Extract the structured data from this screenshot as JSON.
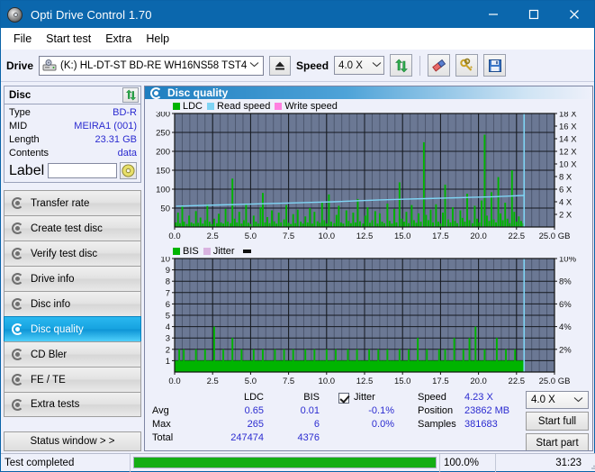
{
  "window": {
    "title": "Opti Drive Control 1.70",
    "icon": "disc-icon",
    "minimize": "minimize-icon",
    "maximize": "maximize-icon",
    "close": "close-icon"
  },
  "menu": {
    "items": [
      "File",
      "Start test",
      "Extra",
      "Help"
    ]
  },
  "toolbar": {
    "drive_label": "Drive",
    "drive_value": "(K:)  HL-DT-ST BD-RE  WH16NS58 TST4",
    "eject_icon": "eject-icon",
    "speed_label": "Speed",
    "speed_value": "4.0 X",
    "refresh_icon": "refresh-icon",
    "erase_icon": "eraser-icon",
    "keys_icon": "keys-icon",
    "save_icon": "save-icon"
  },
  "disc": {
    "title": "Disc",
    "refresh_icon": "refresh-icon",
    "rows": [
      {
        "key": "Type",
        "value": "BD-R"
      },
      {
        "key": "MID",
        "value": "MEIRA1 (001)"
      },
      {
        "key": "Length",
        "value": "23.31 GB"
      },
      {
        "key": "Contents",
        "value": "data"
      }
    ],
    "label_key": "Label",
    "label_value": "",
    "disc_button_icon": "cd-icon"
  },
  "sidebar": {
    "items": [
      {
        "label": "Transfer rate",
        "active": false
      },
      {
        "label": "Create test disc",
        "active": false
      },
      {
        "label": "Verify test disc",
        "active": false
      },
      {
        "label": "Drive info",
        "active": false
      },
      {
        "label": "Disc info",
        "active": false
      },
      {
        "label": "Disc quality",
        "active": true
      },
      {
        "label": "CD Bler",
        "active": false
      },
      {
        "label": "FE / TE",
        "active": false
      },
      {
        "label": "Extra tests",
        "active": false
      }
    ],
    "status_window": "Status window > >"
  },
  "main": {
    "title": "Disc quality",
    "icon": "disc-quality-icon"
  },
  "stats": {
    "col_headers": [
      "",
      "LDC",
      "BIS"
    ],
    "rows": [
      {
        "label": "Avg",
        "ldc": "0.65",
        "bis": "0.01",
        "jitter": "-0.1%"
      },
      {
        "label": "Max",
        "ldc": "265",
        "bis": "6",
        "jitter": "0.0%"
      },
      {
        "label": "Total",
        "ldc": "247474",
        "bis": "4376",
        "jitter": ""
      }
    ],
    "jitter_label": "Jitter",
    "jitter_checked": true,
    "speed_label": "Speed",
    "speed_value": "4.23 X",
    "position_label": "Position",
    "position_value": "23862 MB",
    "samples_label": "Samples",
    "samples_value": "381683",
    "speed_select": "4.0 X",
    "start_full": "Start full",
    "start_part": "Start part"
  },
  "statusbar": {
    "message": "Test completed",
    "percent_label": "100.0%",
    "percent": 100,
    "time": "31:23"
  },
  "colors": {
    "ldc": "#00b400",
    "bis": "#00b400",
    "read_speed": "#7fd4f4",
    "write_speed": "#ff7fe0",
    "jitter": "#d9b3e0",
    "plot_bg": "#6b7894",
    "accent": "#0b67ad",
    "value_text": "#2b2bd0",
    "progress": "#14ae14"
  },
  "chart_data": [
    {
      "type": "bar",
      "id": "ldc-chart",
      "title": "",
      "legend": [
        {
          "label": "LDC",
          "color": "#00b400"
        },
        {
          "label": "Read speed",
          "color": "#7fd4f4"
        },
        {
          "label": "Write speed",
          "color": "#ff7fe0"
        }
      ],
      "legend_position": "top-left",
      "xlabel": "",
      "x_unit": "GB",
      "xlim": [
        0,
        25
      ],
      "xticks": [
        0.0,
        2.5,
        5.0,
        7.5,
        10.0,
        12.5,
        15.0,
        17.5,
        20.0,
        22.5,
        25.0
      ],
      "xtick_labels": [
        "0.0",
        "2.5",
        "5.0",
        "7.5",
        "10.0",
        "12.5",
        "15.0",
        "17.5",
        "20.0",
        "22.5",
        "25.0 GB"
      ],
      "ylabel": "",
      "ylim": [
        0,
        300
      ],
      "yticks": [
        50,
        100,
        150,
        200,
        250,
        300
      ],
      "ytick_labels": [
        "50",
        "100",
        "150",
        "200",
        "250",
        "300"
      ],
      "y2lim": [
        0,
        18
      ],
      "y2ticks": [
        2,
        4,
        6,
        8,
        10,
        12,
        14,
        16,
        18
      ],
      "y2tick_labels": [
        "2 X",
        "4 X",
        "6 X",
        "8 X",
        "10 X",
        "12 X",
        "14 X",
        "16 X",
        "18 X"
      ],
      "grid": true,
      "data_end_x": 23.0,
      "series": [
        {
          "name": "LDC",
          "color": "#00b400",
          "type": "bar",
          "x": [
            0.08,
            0.22,
            0.35,
            0.5,
            0.62,
            0.8,
            0.95,
            1.1,
            1.25,
            1.4,
            1.55,
            1.7,
            1.85,
            2.0,
            2.15,
            2.3,
            2.45,
            2.6,
            2.78,
            2.9,
            3.05,
            3.2,
            3.35,
            3.5,
            3.68,
            3.8,
            3.95,
            4.1,
            4.25,
            4.4,
            4.55,
            4.7,
            4.85,
            5.0,
            5.2,
            5.35,
            5.5,
            5.65,
            5.8,
            5.95,
            6.1,
            6.25,
            6.4,
            6.55,
            6.7,
            6.85,
            7.0,
            7.2,
            7.35,
            7.5,
            7.65,
            7.8,
            7.95,
            8.1,
            8.3,
            8.45,
            8.6,
            8.75,
            8.9,
            9.05,
            9.2,
            9.4,
            9.55,
            9.7,
            9.85,
            10.0,
            10.15,
            10.3,
            10.5,
            10.65,
            10.8,
            10.95,
            11.1,
            11.3,
            11.45,
            11.6,
            11.75,
            11.9,
            12.05,
            12.2,
            12.4,
            12.55,
            12.7,
            12.85,
            13.0,
            13.2,
            13.35,
            13.5,
            13.65,
            13.8,
            14.0,
            14.15,
            14.3,
            14.45,
            14.6,
            14.8,
            14.95,
            15.1,
            15.25,
            15.4,
            15.6,
            15.75,
            15.9,
            16.05,
            16.2,
            16.4,
            16.55,
            16.7,
            16.85,
            17.0,
            17.2,
            17.35,
            17.5,
            17.65,
            17.8,
            18.0,
            18.15,
            18.3,
            18.45,
            18.6,
            18.8,
            18.95,
            19.1,
            19.25,
            19.4,
            19.6,
            19.75,
            19.9,
            20.05,
            20.2,
            20.4,
            20.55,
            20.7,
            20.85,
            21.0,
            21.15,
            21.3,
            21.45,
            21.6,
            21.75,
            21.9,
            22.05,
            22.2,
            22.35,
            22.5,
            22.65,
            22.8,
            22.95
          ],
          "values": [
            12,
            38,
            10,
            55,
            14,
            8,
            30,
            12,
            9,
            42,
            11,
            25,
            9,
            18,
            60,
            14,
            8,
            22,
            10,
            35,
            12,
            9,
            48,
            14,
            10,
            128,
            22,
            12,
            40,
            9,
            18,
            62,
            11,
            8,
            30,
            14,
            9,
            52,
            90,
            12,
            26,
            10,
            44,
            15,
            9,
            38,
            12,
            20,
            58,
            11,
            8,
            34,
            10,
            46,
            14,
            9,
            28,
            12,
            50,
            9,
            40,
            15,
            11,
            66,
            18,
            9,
            86,
            14,
            10,
            32,
            56,
            12,
            9,
            44,
            16,
            10,
            38,
            12,
            74,
            15,
            9,
            30,
            52,
            11,
            18,
            42,
            9,
            36,
            14,
            10,
            62,
            16,
            9,
            48,
            12,
            118,
            22,
            14,
            40,
            10,
            58,
            18,
            11,
            36,
            14,
            224,
            32,
            18,
            46,
            12,
            60,
            14,
            9,
            38,
            112,
            20,
            12,
            52,
            16,
            10,
            44,
            24,
            14,
            88,
            18,
            10,
            56,
            22,
            12,
            70,
            244,
            30,
            16,
            92,
            20,
            12,
            132,
            36,
            18,
            64,
            22,
            10,
            150,
            40,
            14,
            28,
            16,
            10
          ]
        },
        {
          "name": "Read speed",
          "color": "#7fd4f4",
          "type": "line",
          "axis": "y2",
          "x": [
            0.1,
            1.5,
            3.0,
            4.5,
            6.0,
            7.5,
            9.0,
            10.5,
            12.0,
            13.5,
            15.0,
            16.5,
            18.0,
            19.5,
            21.0,
            22.0,
            23.0
          ],
          "values": [
            3.3,
            3.4,
            3.5,
            3.6,
            3.7,
            3.8,
            3.9,
            4.0,
            4.15,
            4.3,
            4.4,
            4.5,
            4.6,
            4.7,
            4.8,
            4.9,
            5.0
          ]
        },
        {
          "name": "Write speed",
          "color": "#ff7fe0",
          "type": "line",
          "axis": "y2",
          "x": [],
          "values": []
        }
      ]
    },
    {
      "type": "bar",
      "id": "bis-chart",
      "title": "",
      "legend": [
        {
          "label": "BIS",
          "color": "#00b400"
        },
        {
          "label": "Jitter",
          "color": "#d9b3e0"
        }
      ],
      "legend_position": "top-left",
      "xlabel": "",
      "x_unit": "GB",
      "xlim": [
        0,
        25
      ],
      "xticks": [
        0.0,
        2.5,
        5.0,
        7.5,
        10.0,
        12.5,
        15.0,
        17.5,
        20.0,
        22.5,
        25.0
      ],
      "xtick_labels": [
        "0.0",
        "2.5",
        "5.0",
        "7.5",
        "10.0",
        "12.5",
        "15.0",
        "17.5",
        "20.0",
        "22.5",
        "25.0 GB"
      ],
      "ylabel": "",
      "ylim": [
        0,
        10
      ],
      "yticks": [
        1,
        2,
        3,
        4,
        5,
        6,
        7,
        8,
        9,
        10
      ],
      "ytick_labels": [
        "1",
        "2",
        "3",
        "4",
        "5",
        "6",
        "7",
        "8",
        "9",
        "10"
      ],
      "y2lim": [
        0,
        10
      ],
      "y2ticks": [
        2,
        4,
        6,
        8,
        10
      ],
      "y2tick_labels": [
        "2%",
        "4%",
        "6%",
        "8%",
        "10%"
      ],
      "grid": true,
      "data_end_x": 23.0,
      "series": [
        {
          "name": "BIS",
          "color": "#00b400",
          "type": "bar",
          "x": [
            0.1,
            0.3,
            0.45,
            0.6,
            0.8,
            1.0,
            1.2,
            1.4,
            1.6,
            1.8,
            2.0,
            2.2,
            2.4,
            2.6,
            2.8,
            3.0,
            3.2,
            3.4,
            3.6,
            3.8,
            4.0,
            4.2,
            4.4,
            4.6,
            4.8,
            5.0,
            5.2,
            5.4,
            5.6,
            5.8,
            6.0,
            6.2,
            6.4,
            6.6,
            6.8,
            7.0,
            7.2,
            7.4,
            7.6,
            7.8,
            8.0,
            8.2,
            8.4,
            8.6,
            8.8,
            9.0,
            9.2,
            9.4,
            9.6,
            9.8,
            10.0,
            10.2,
            10.4,
            10.6,
            10.8,
            11.0,
            11.2,
            11.4,
            11.6,
            11.8,
            12.0,
            12.2,
            12.4,
            12.6,
            12.8,
            13.0,
            13.2,
            13.4,
            13.6,
            13.8,
            14.0,
            14.2,
            14.4,
            14.6,
            14.8,
            15.0,
            15.2,
            15.4,
            15.6,
            15.8,
            16.0,
            16.2,
            16.4,
            16.6,
            16.8,
            17.0,
            17.2,
            17.4,
            17.6,
            17.8,
            18.0,
            18.2,
            18.4,
            18.6,
            18.8,
            19.0,
            19.2,
            19.4,
            19.6,
            19.8,
            20.0,
            20.2,
            20.4,
            20.6,
            20.8,
            21.0,
            21.2,
            21.4,
            21.6,
            21.8,
            22.0,
            22.2,
            22.4,
            22.6,
            22.8,
            22.95
          ],
          "values": [
            1,
            2,
            1,
            2,
            1,
            1,
            1,
            2,
            1,
            1,
            2,
            1,
            1,
            4,
            1,
            1,
            2,
            1,
            1,
            3,
            1,
            1,
            2,
            1,
            1,
            1,
            2,
            1,
            1,
            2,
            1,
            1,
            1,
            2,
            1,
            1,
            2,
            1,
            1,
            2,
            1,
            1,
            1,
            2,
            1,
            1,
            2,
            1,
            1,
            1,
            2,
            1,
            1,
            2,
            1,
            1,
            1,
            2,
            1,
            1,
            2,
            1,
            1,
            1,
            2,
            1,
            1,
            2,
            1,
            1,
            2,
            1,
            1,
            1,
            2,
            1,
            1,
            2,
            1,
            1,
            3,
            1,
            1,
            2,
            1,
            1,
            1,
            2,
            1,
            2,
            1,
            1,
            3,
            1,
            1,
            2,
            1,
            3,
            1,
            4,
            1,
            1,
            2,
            1,
            1,
            1,
            3,
            1,
            1,
            2,
            1,
            1,
            2,
            1,
            1,
            1
          ]
        },
        {
          "name": "Jitter",
          "color": "#d9b3e0",
          "type": "line",
          "axis": "y2",
          "x": [],
          "values": []
        }
      ]
    }
  ]
}
